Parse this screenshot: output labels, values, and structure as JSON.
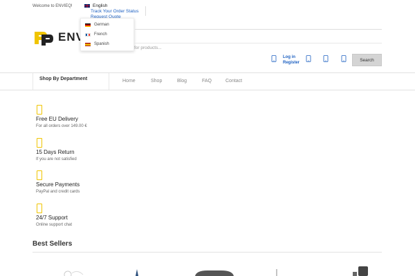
{
  "topbar": {
    "welcome": "Welcome to ENVIEQ!"
  },
  "language": {
    "current": "English",
    "options": [
      "German",
      "French",
      "Spanish"
    ]
  },
  "toplinks": {
    "track_order": "Track Your Order Status",
    "request_quote": "Request Quote"
  },
  "logo": {
    "text": "ENV"
  },
  "search": {
    "placeholder": "for products...",
    "button": "Search"
  },
  "account": {
    "login": "Log in",
    "register": "Register"
  },
  "nav": {
    "department": "Shop By Department",
    "items": [
      "Home",
      "Shop",
      "Blog",
      "FAQ",
      "Contact"
    ]
  },
  "features": [
    {
      "title": "Free EU Delivery",
      "subtitle": "For all orders over 149.00 €"
    },
    {
      "title": "15 Days Return",
      "subtitle": "If you are not satisfied"
    },
    {
      "title": "Secure Payments",
      "subtitle": "PayPal and credit cards"
    },
    {
      "title": "24/7 Support",
      "subtitle": "Online support chat"
    }
  ],
  "best_sellers": {
    "title": "Best Sellers"
  },
  "colors": {
    "accent": "#f0c400",
    "link": "#1b5fc1",
    "button": "#d4d4d4"
  }
}
